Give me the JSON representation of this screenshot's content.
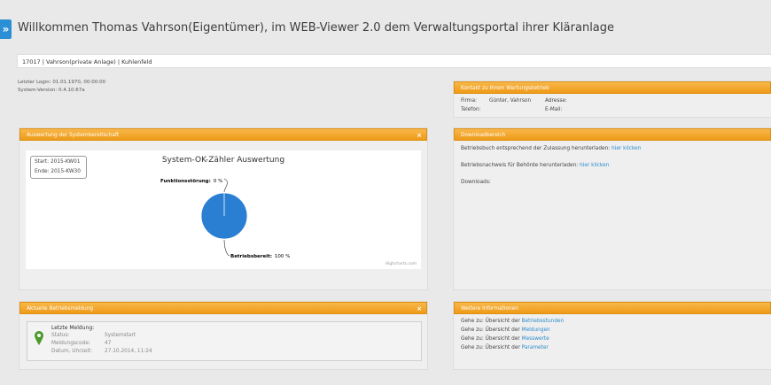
{
  "header": {
    "menu_toggle": "»",
    "welcome": "Willkommen Thomas Vahrson(Eigentümer), im WEB-Viewer 2.0 dem Verwaltungsportal ihrer Kläranlage",
    "plant": "17017 | Vahrson(private Anlage) | Kuhlenfeld"
  },
  "meta": {
    "last_login": "Letzter Login: 01.01.1970, 00:00:00",
    "system_version": "System-Version: 0.4.10.67a"
  },
  "availability": {
    "title": "Auswertung der Systembereitschaft",
    "close": "×",
    "range": {
      "start_label": "Start:",
      "start": "2015-KW01",
      "end_label": "Ende:",
      "end": "2015-KW30"
    },
    "credit": "Highcharts.com"
  },
  "chart_data": {
    "type": "pie",
    "title": "System-OK-Zähler Auswertung",
    "slices": [
      {
        "label": "Funktionsstörung",
        "value_text": "0 %",
        "value": 0
      },
      {
        "label": "Betriebsbereit",
        "value_text": "100 %",
        "value": 100
      }
    ],
    "colors": {
      "Betriebsbereit": "#2b7fd3",
      "Funktionsstörung": "#434348"
    }
  },
  "current_message": {
    "title": "Aktuelle Betriebsmeldung",
    "close": "×",
    "heading": "Letzte Meldung:",
    "rows": [
      {
        "label": "Status:",
        "value": "Systemstart"
      },
      {
        "label": "Meldungscode:",
        "value": "47"
      },
      {
        "label": "Datum, Uhrzeit:",
        "value": "27.10.2014, 11:24"
      }
    ]
  },
  "contact": {
    "title": "Kontakt zu Ihrem Wartungsbetrieb",
    "firma_label": "Firma:",
    "firma": "Günter, Vahrson",
    "adresse_label": "Adresse:",
    "telefon_label": "Telefon:",
    "email_label": "E-Mail:"
  },
  "downloads": {
    "title": "Downloadbereich",
    "line1_text": "Betriebsbuch entsprechend der Zulassung herunterladen:",
    "line1_link": "hier klicken",
    "line2_text": "Betriebsnachweis für Behörde herunterladen:",
    "line2_link": "hier klicken",
    "downloads_label": "Downloads:"
  },
  "more_info": {
    "title": "Weitere Informationen",
    "prefix": "Gehe zu: Übersicht der",
    "links": [
      "Betriebsstunden",
      "Meldungen",
      "Messwerte",
      "Parameter"
    ]
  },
  "colors": {
    "accent_orange": "#f2a328",
    "link_blue": "#2b8ccc",
    "pie_blue": "#2b7fd3",
    "menu_blue": "#2a8fd4"
  }
}
